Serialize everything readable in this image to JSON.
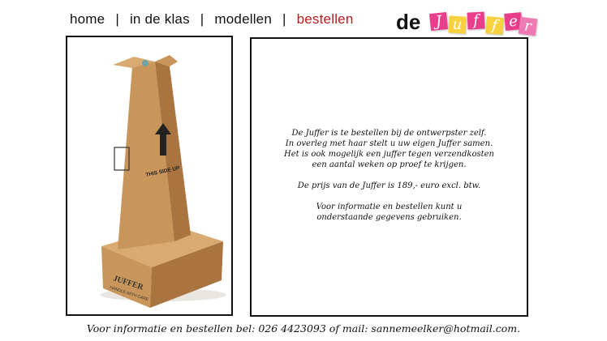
{
  "nav": {
    "items": [
      {
        "label": "home",
        "active": false
      },
      {
        "label": "in de klas",
        "active": false
      },
      {
        "label": "modellen",
        "active": false
      },
      {
        "label": "bestellen",
        "active": true
      }
    ],
    "separator": "|"
  },
  "logo": {
    "prefix": "de",
    "letters": [
      {
        "char": "J",
        "color": "#e83e8c"
      },
      {
        "char": "u",
        "color": "#f7d23e"
      },
      {
        "char": "f",
        "color": "#e83e8c"
      },
      {
        "char": "f",
        "color": "#f7d23e"
      },
      {
        "char": "e",
        "color": "#e83e8c"
      },
      {
        "char": "r",
        "color": "#ef7ab3"
      }
    ]
  },
  "product_image": {
    "box_text_side": "THIS SIDE UP",
    "box_text_front": "JUFFER",
    "box_text_front_sub": "HANDLE WITH CARE",
    "colors": {
      "cardboard": "#c8955a",
      "cardboard_dark": "#a9743f",
      "cardboard_light": "#d9ab72"
    }
  },
  "content": {
    "paragraph1": [
      "De Juffer is te bestellen bij de ontwerpster zelf.",
      "In overleg met haar stelt u uw eigen Juffer samen.",
      "Het is ook mogelijk een juffer tegen verzendkosten",
      "een aantal weken op proef te krijgen."
    ],
    "paragraph2": "De prijs van de Juffer is 189,- euro excl. btw.",
    "paragraph3": [
      "Voor informatie en bestellen kunt u",
      "onderstaande gegevens gebruiken."
    ]
  },
  "footer": {
    "text": "Voor informatie en bestellen bel: 026 4423093 of mail: ",
    "email": "sannemeelker@hotmail.com."
  }
}
